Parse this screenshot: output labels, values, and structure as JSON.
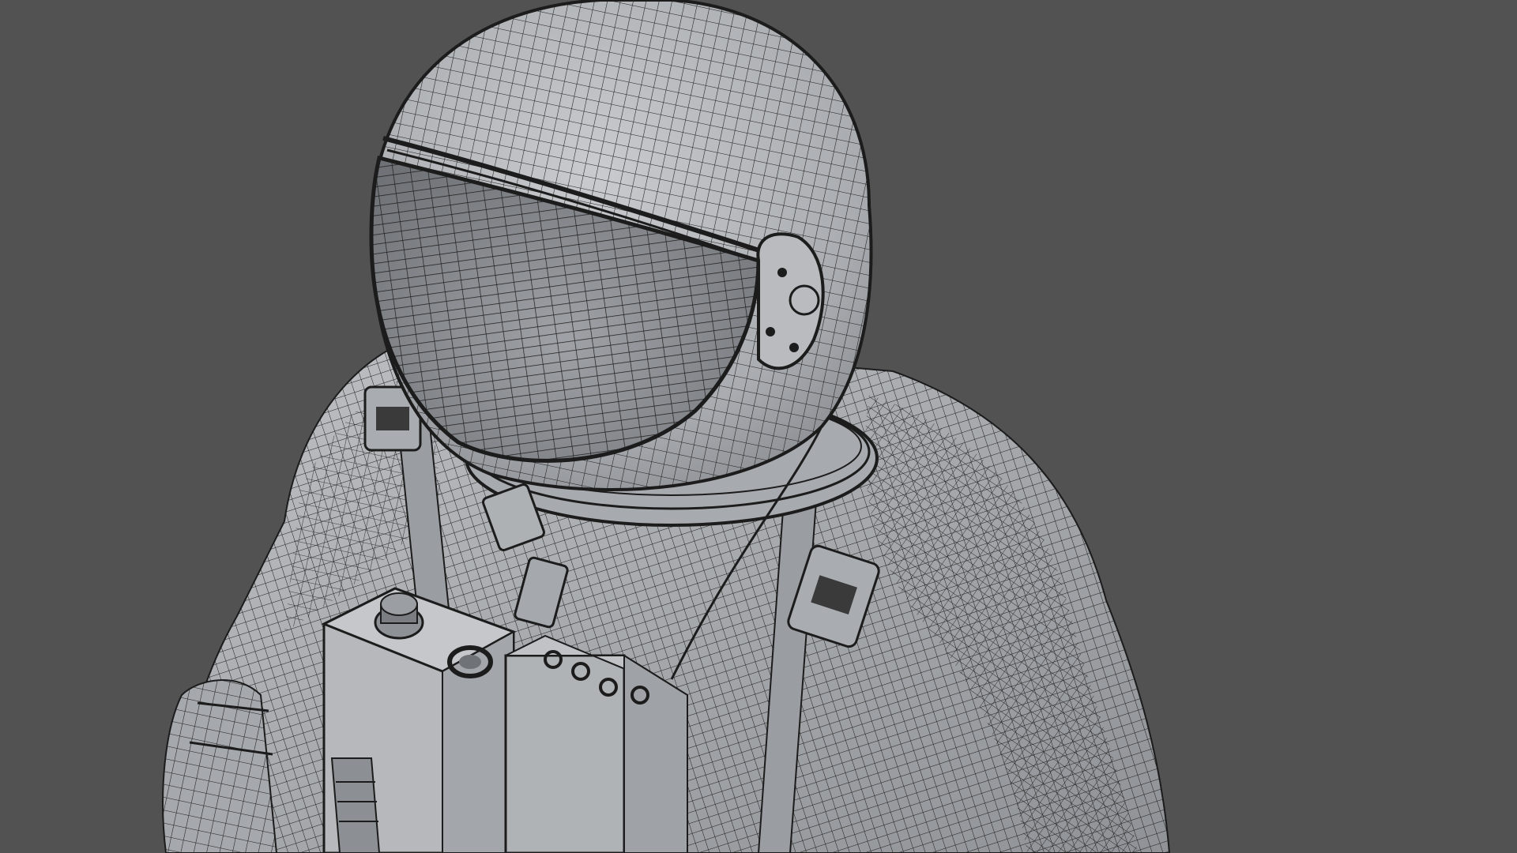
{
  "scene": {
    "background_color": "#525252",
    "model_fill_color": "#b4b6b9",
    "shadow_color": "#7d8084",
    "wire_color": "#1c1c1c",
    "subject": "astronaut-wireframe-render"
  }
}
